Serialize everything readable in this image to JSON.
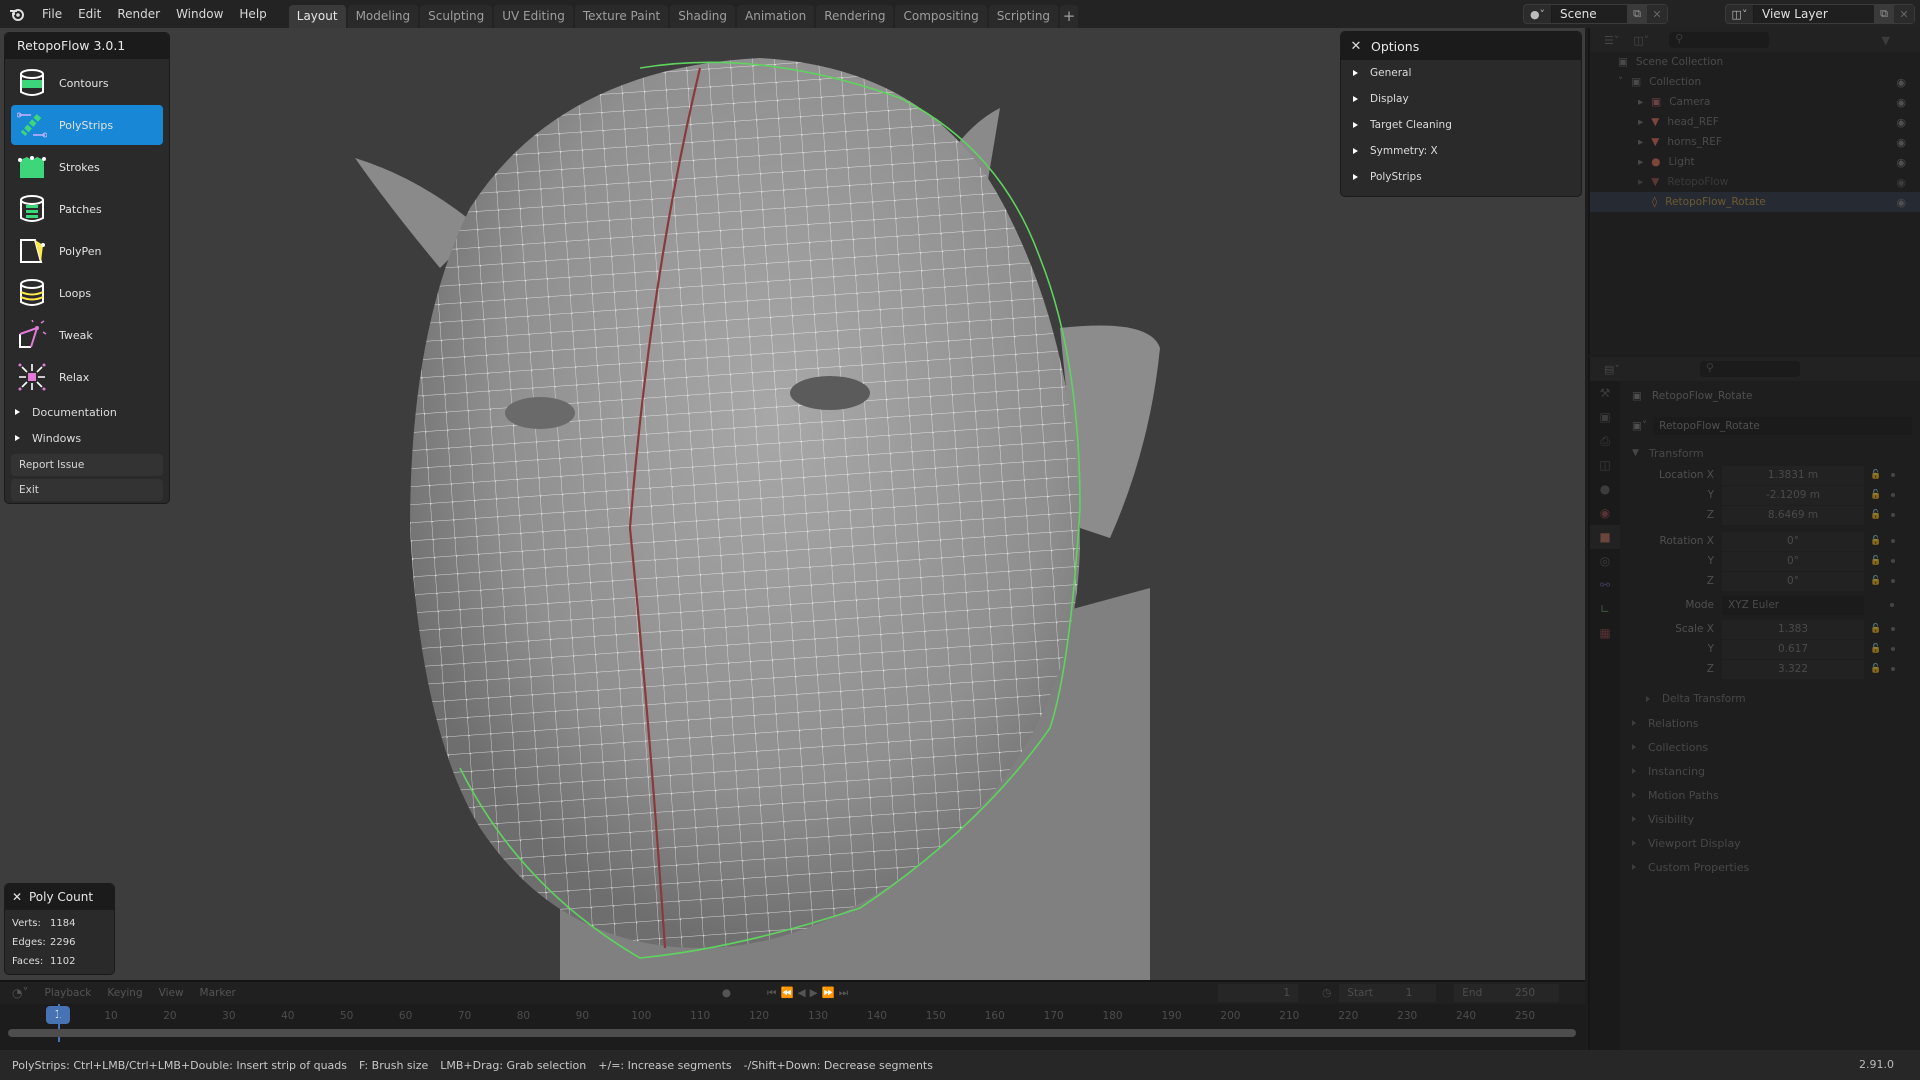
{
  "topbar": {
    "menus": [
      "File",
      "Edit",
      "Render",
      "Window",
      "Help"
    ],
    "workspaces": [
      "Layout",
      "Modeling",
      "Sculpting",
      "UV Editing",
      "Texture Paint",
      "Shading",
      "Animation",
      "Rendering",
      "Compositing",
      "Scripting"
    ],
    "active_workspace": "Layout",
    "add_workspace": "+",
    "scene": "Scene",
    "view_layer": "View Layer"
  },
  "retopoflow": {
    "title": "RetopoFlow 3.0.1",
    "tools": [
      {
        "label": "Contours",
        "icon": "contours-icon"
      },
      {
        "label": "PolyStrips",
        "icon": "polystrips-icon",
        "active": true
      },
      {
        "label": "Strokes",
        "icon": "strokes-icon"
      },
      {
        "label": "Patches",
        "icon": "patches-icon"
      },
      {
        "label": "PolyPen",
        "icon": "polypen-icon"
      },
      {
        "label": "Loops",
        "icon": "loops-icon"
      },
      {
        "label": "Tweak",
        "icon": "tweak-icon"
      },
      {
        "label": "Relax",
        "icon": "relax-icon"
      }
    ],
    "sections": [
      "Documentation",
      "Windows"
    ],
    "buttons": [
      "Report Issue",
      "Exit"
    ]
  },
  "options": {
    "title": "Options",
    "items": [
      "General",
      "Display",
      "Target Cleaning",
      "Symmetry: X",
      "PolyStrips"
    ]
  },
  "poly_count": {
    "title": "Poly Count",
    "rows": [
      {
        "label": "Verts:",
        "value": "1184"
      },
      {
        "label": "Edges:",
        "value": "2296"
      },
      {
        "label": "Faces:",
        "value": "1102"
      }
    ]
  },
  "outliner": {
    "items": [
      {
        "label": "Scene Collection",
        "level": 0
      },
      {
        "label": "Collection",
        "level": 1
      },
      {
        "label": "Camera",
        "level": 2
      },
      {
        "label": "head_REF",
        "level": 2
      },
      {
        "label": "horns_REF",
        "level": 2
      },
      {
        "label": "Light",
        "level": 2
      },
      {
        "label": "RetopoFlow",
        "level": 2
      },
      {
        "label": "RetopoFlow_Rotate",
        "level": 2,
        "selected": true
      }
    ]
  },
  "properties": {
    "object_name": "RetopoFlow_Rotate",
    "object_field": "RetopoFlow_Rotate",
    "transform_label": "Transform",
    "location": {
      "label": "Location X",
      "x": "1.3831 m",
      "y": "-2.1209 m",
      "z": "8.6469 m"
    },
    "rotation": {
      "label": "Rotation X",
      "x": "0°",
      "y": "0°",
      "z": "0°"
    },
    "mode": {
      "label": "Mode",
      "value": "XYZ Euler"
    },
    "scale": {
      "label": "Scale X",
      "x": "1.383",
      "y": "0.617",
      "z": "3.322"
    },
    "axis_labels": {
      "y": "Y",
      "z": "Z"
    },
    "subsections": [
      "Delta Transform"
    ],
    "sections": [
      "Relations",
      "Collections",
      "Instancing",
      "Motion Paths",
      "Visibility",
      "Viewport Display",
      "Custom Properties"
    ]
  },
  "timeline": {
    "menus": [
      "Playback",
      "Keying",
      "View",
      "Marker"
    ],
    "current_frame": "1",
    "ticks": [
      "10",
      "20",
      "30",
      "40",
      "50",
      "60",
      "70",
      "80",
      "90",
      "100",
      "110",
      "120",
      "130",
      "140",
      "150",
      "160",
      "170",
      "180",
      "190",
      "200",
      "210",
      "220",
      "230",
      "240",
      "250"
    ],
    "frame_field": "1",
    "start_label": "Start",
    "start": "1",
    "end_label": "End",
    "end": "250"
  },
  "statusbar": {
    "hints": [
      "PolyStrips: Ctrl+LMB/Ctrl+LMB+Double: Insert strip of quads",
      "F: Brush size",
      "LMB+Drag: Grab selection",
      "+/=: Increase segments",
      "-/Shift+Down: Decrease segments"
    ],
    "version": "2.91.0"
  },
  "colors": {
    "accent": "#1787d6",
    "frame_cursor": "#4772b3",
    "mesh_wire": "#ffffff",
    "seam": "#8a3a3a",
    "selection": "#5fd35f"
  }
}
